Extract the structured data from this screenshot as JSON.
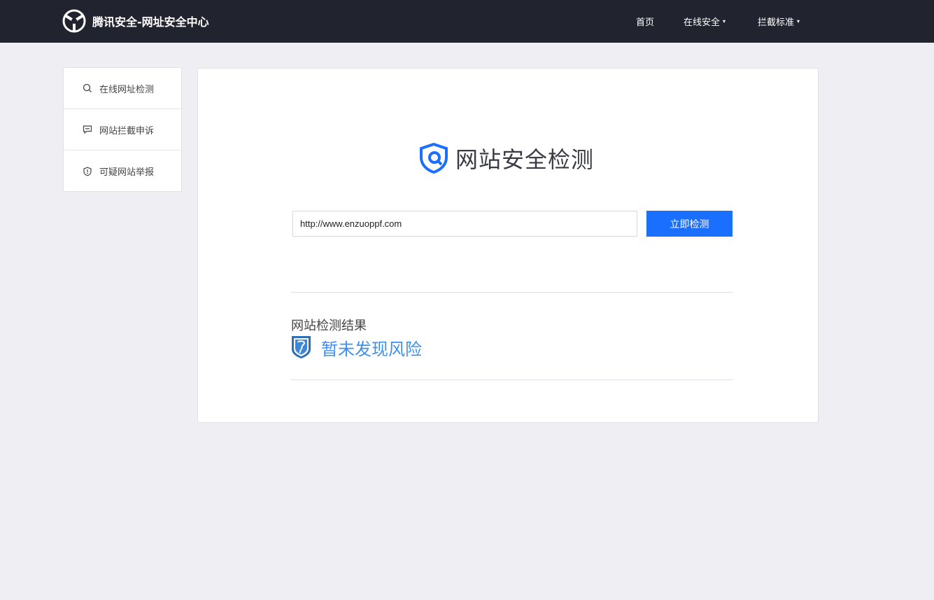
{
  "header": {
    "brand_title": "腾讯安全-网址安全中心",
    "nav": [
      {
        "label": "首页",
        "has_caret": false
      },
      {
        "label": "在线安全",
        "has_caret": true
      },
      {
        "label": "拦截标准",
        "has_caret": true
      }
    ],
    "caret": "▾"
  },
  "sidebar": {
    "items": [
      {
        "label": "在线网址检测",
        "icon": "search-icon"
      },
      {
        "label": "网站拦截申诉",
        "icon": "message-icon"
      },
      {
        "label": "可疑网站举报",
        "icon": "shield-alert-icon"
      }
    ]
  },
  "main": {
    "title": "网站安全检测",
    "url_value": "http://www.enzuoppf.com",
    "check_button": "立即检测",
    "result_heading": "网站检测结果",
    "result_status": "暂未发现风险"
  },
  "colors": {
    "topbar": "#21232f",
    "accent": "#1a6fff",
    "result_text": "#3f8ff0",
    "background": "#efeff3"
  }
}
